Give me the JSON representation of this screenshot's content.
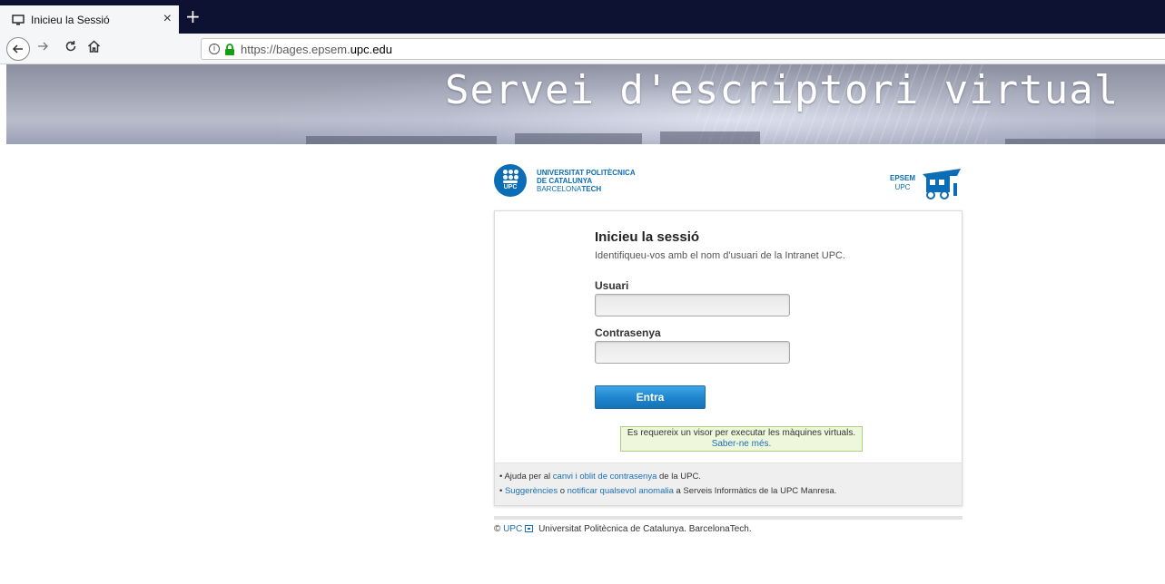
{
  "browser": {
    "tab_title": "Inicieu la Sessió",
    "tab_close": "×",
    "new_tab": "+",
    "url_prefix": "https://bages.epsem.",
    "url_host": "upc.edu"
  },
  "banner": {
    "title": "Servei d'escriptori virtual"
  },
  "logos": {
    "upc_line1": "UNIVERSITAT POLITÈCNICA",
    "upc_line2": "DE CATALUNYA",
    "upc_line3a": "BARCELONA",
    "upc_line3b": "TECH",
    "upc_circle": "UPC",
    "epsem_line1": "EPSEM",
    "epsem_line2": "UPC"
  },
  "login": {
    "title": "Inicieu la sessió",
    "subtitle": "Identifiqueu-vos amb el nom d'usuari de la Intranet UPC.",
    "user_label": "Usuari",
    "user_value": "",
    "password_label": "Contrasenya",
    "password_value": "",
    "submit_label": "Entra",
    "notice_text": "Es requereix un visor per executar les màquines virtuals.",
    "notice_link": "Saber-ne més."
  },
  "footer": {
    "line1_prefix": "• Ajuda per al ",
    "line1_link": "canvi i oblit de contrasenya",
    "line1_suffix": " de la UPC.",
    "line2_bullet": "• ",
    "line2_link1": "Suggerències",
    "line2_mid": " o ",
    "line2_link2": "notificar qualsevol anomalia",
    "line2_suffix": " a Serveis Informàtics de la UPC Manresa."
  },
  "copyright": {
    "symbol": "©",
    "link": "UPC",
    "text": "Universitat Politècnica de Catalunya. BarcelonaTech."
  },
  "colors": {
    "tabbar": "#0d1233",
    "upc_blue": "#0a6db5",
    "link": "#1a6fb3",
    "button": "#1e84cc",
    "notice_bg": "#eef7dc",
    "notice_border": "#a7d07a"
  }
}
